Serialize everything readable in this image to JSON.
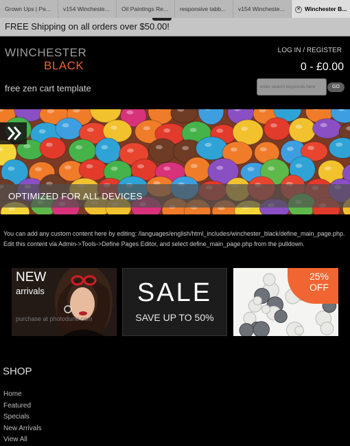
{
  "tabs": [
    {
      "label": "Grown Ups | Pe..."
    },
    {
      "label": "v154 Wincheste..."
    },
    {
      "label": "Oil Paintings Re..."
    },
    {
      "label": "responsive tabb..."
    },
    {
      "label": "v154 Wincheste..."
    },
    {
      "label": "Winchester B..."
    }
  ],
  "shipping": {
    "text": "FREE Shipping on all orders over $50.00!"
  },
  "header": {
    "logo_line1": "WINCHESTER",
    "logo_line2": "BLACK",
    "tagline": "free zen cart template",
    "login": "LOG IN / REGISTER",
    "cart_total": "0 - £0.00",
    "search_placeholder": "enter search keywords here",
    "go_label": "GO"
  },
  "slider": {
    "caption": "OPTIMIZED FOR ALL DEVICES",
    "next_icon": "double-chevron-right-icon"
  },
  "main": {
    "custom_text": "You can add any custom content here by editing: /languages/english/html_includes/winchester_black/define_main_page.php. Edit this content via Admin->Tools->Define Pages Editor, and select define_main_page.php from the pulldown."
  },
  "banners": {
    "new": {
      "title": "NEW",
      "subtitle": "arrivals",
      "credit": "purchase at photodune.com"
    },
    "sale": {
      "title": "SALE",
      "subtitle": "SAVE UP TO 50%"
    },
    "discount": {
      "line1": "25%",
      "line2": "OFF"
    }
  },
  "shop": {
    "heading": "SHOP",
    "links": [
      "Home",
      "Featured",
      "Specials",
      "New Arrivals",
      "View All"
    ]
  },
  "colors": {
    "accent": "#ef6131",
    "background": "#000000",
    "text": "#cfcfcf"
  }
}
